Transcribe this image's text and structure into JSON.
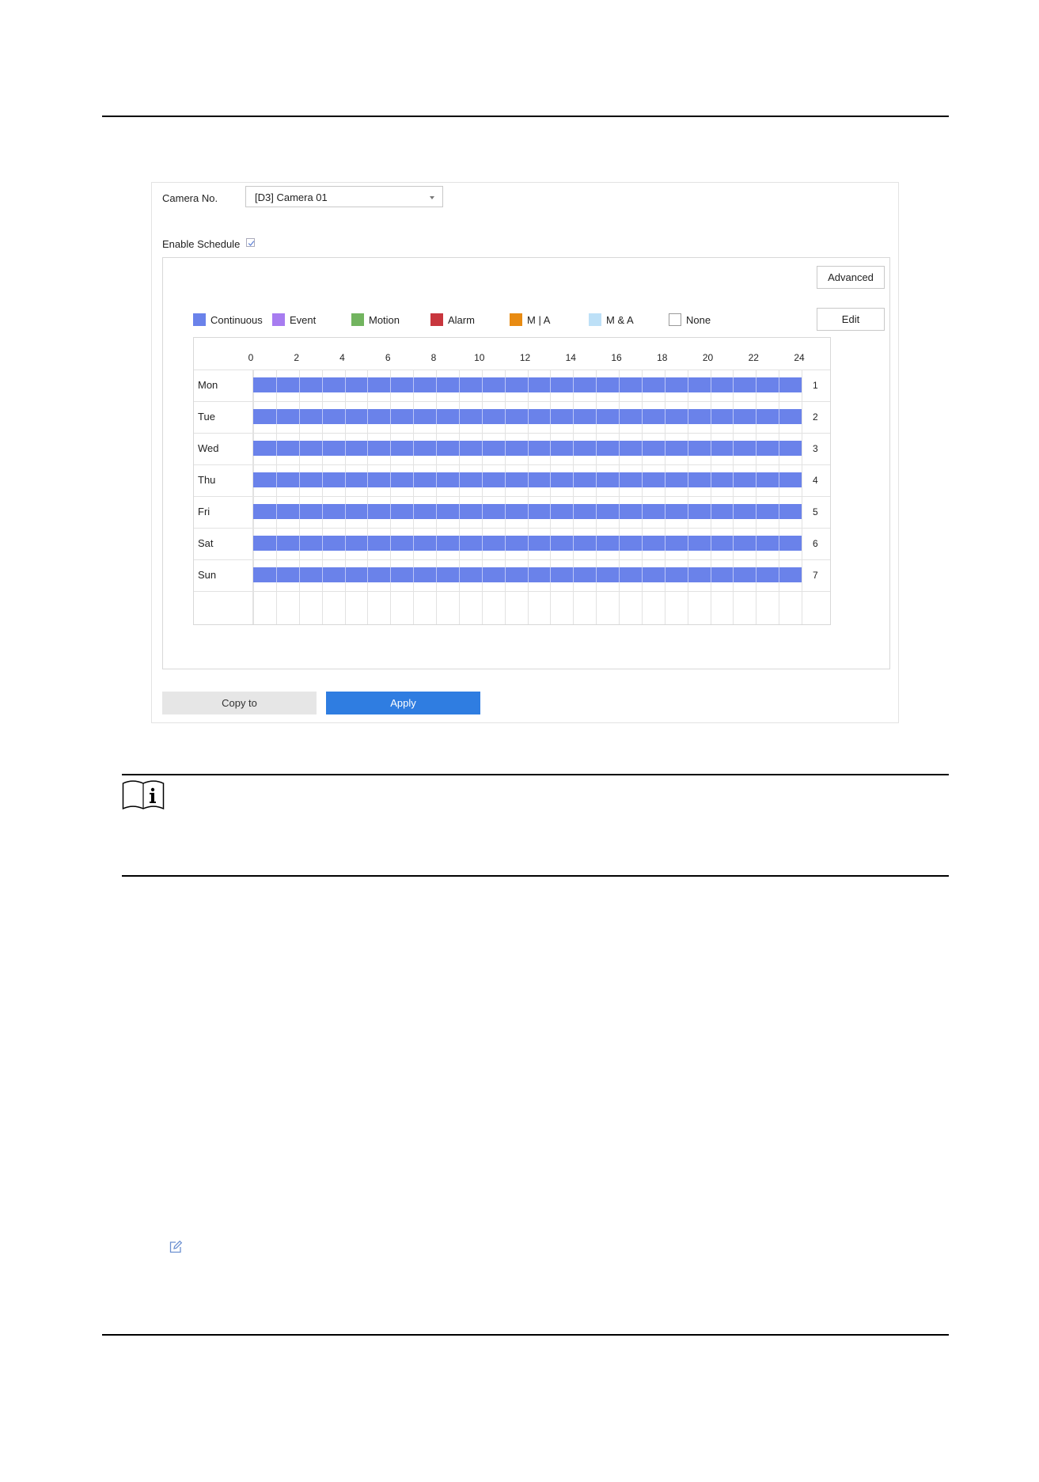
{
  "form": {
    "camera_label": "Camera No.",
    "camera_value": "[D3] Camera 01",
    "enable_label": "Enable Schedule",
    "enable_checked": true
  },
  "buttons": {
    "advanced": "Advanced",
    "edit": "Edit",
    "copy": "Copy to",
    "apply": "Apply"
  },
  "legend": [
    {
      "label": "Continuous",
      "color": "#6a82ea",
      "border": "#6a82ea"
    },
    {
      "label": "Event",
      "color": "#a77cf0",
      "border": "#a77cf0"
    },
    {
      "label": "Motion",
      "color": "#72b45f",
      "border": "#72b45f"
    },
    {
      "label": "Alarm",
      "color": "#c8363d",
      "border": "#c8363d"
    },
    {
      "label": "M | A",
      "color": "#e88b12",
      "border": "#e88b12"
    },
    {
      "label": "M & A",
      "color": "#bde0f7",
      "border": "#bde0f7"
    },
    {
      "label": "None",
      "color": "#ffffff",
      "border": "#9a9a9a"
    }
  ],
  "schedule": {
    "hours": [
      "0",
      "2",
      "4",
      "6",
      "8",
      "10",
      "12",
      "14",
      "16",
      "18",
      "20",
      "22",
      "24"
    ],
    "days": [
      {
        "label": "Mon",
        "num": "1",
        "type": "Continuous",
        "start": 0,
        "end": 24
      },
      {
        "label": "Tue",
        "num": "2",
        "type": "Continuous",
        "start": 0,
        "end": 24
      },
      {
        "label": "Wed",
        "num": "3",
        "type": "Continuous",
        "start": 0,
        "end": 24
      },
      {
        "label": "Thu",
        "num": "4",
        "type": "Continuous",
        "start": 0,
        "end": 24
      },
      {
        "label": "Fri",
        "num": "5",
        "type": "Continuous",
        "start": 0,
        "end": 24
      },
      {
        "label": "Sat",
        "num": "6",
        "type": "Continuous",
        "start": 0,
        "end": 24
      },
      {
        "label": "Sun",
        "num": "7",
        "type": "Continuous",
        "start": 0,
        "end": 24
      }
    ],
    "bar_color": "#6a82ea"
  },
  "icons": {
    "note": "note-info-icon",
    "edit": "edit-pencil-icon"
  }
}
